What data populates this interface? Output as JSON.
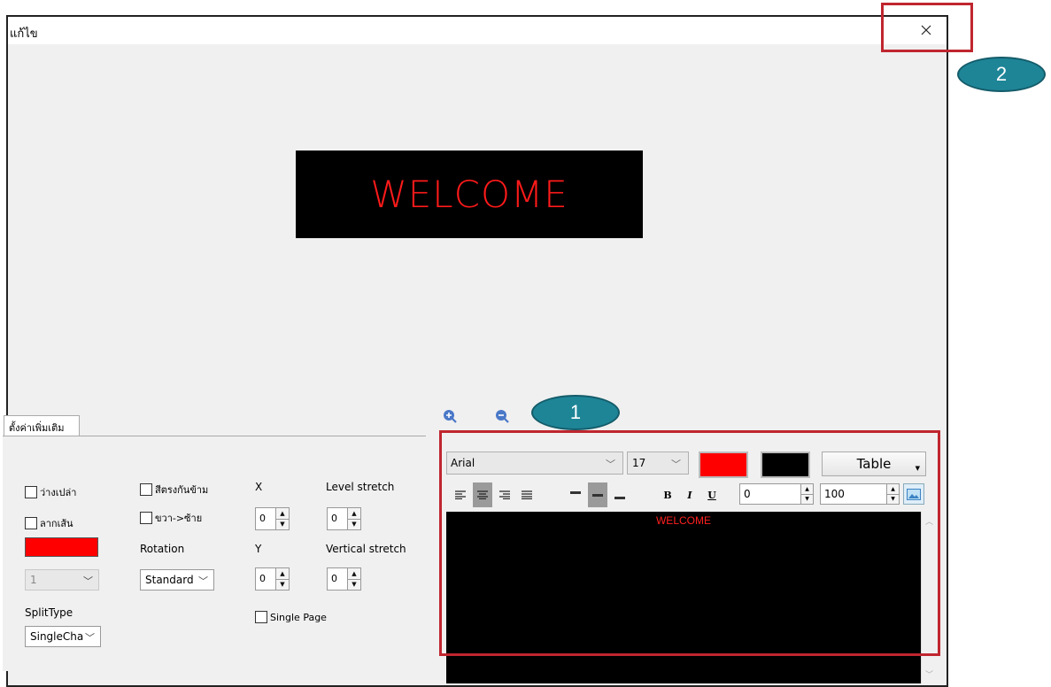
{
  "window": {
    "title": "แก้ไข",
    "close_icon": "close-icon"
  },
  "preview": {
    "text": "WELCOME",
    "text_color": "#ff1a1a",
    "background": "#000000"
  },
  "zoom": {
    "in_icon": "zoom-in-icon",
    "out_icon": "zoom-out-icon"
  },
  "settings": {
    "tab_label": "ตั้งค่าเพิ่มเติม",
    "checkbox_blank": "ว่างเปล่า",
    "checkbox_stroke": "ลากเส้น",
    "checkbox_invert": "สีตรงกันข้าม",
    "checkbox_rtl": "ขวา->ซ้าย",
    "stroke_color": "#ff0000",
    "stroke_width": "1",
    "rotation_label": "Rotation",
    "rotation_value": "Standard",
    "x_label": "X",
    "x_value": "0",
    "y_label": "Y",
    "y_value": "0",
    "level_stretch_label": "Level stretch",
    "level_stretch_value": "0",
    "vertical_stretch_label": "Vertical stretch",
    "vertical_stretch_value": "0",
    "single_page_label": "Single Page",
    "split_type_label": "SplitType",
    "split_type_value": "SingleCha"
  },
  "editor": {
    "font": "Arial",
    "size": "17",
    "fg_color": "#ff0000",
    "bg_color": "#000000",
    "table_label": "Table",
    "bold": "B",
    "italic": "I",
    "underline": "U",
    "spacing_value": "0",
    "scale_value": "100",
    "content": "WELCOME"
  },
  "annotations": {
    "callout_1": "1",
    "callout_2": "2",
    "highlight_color": "#c0262f",
    "callout_color": "#1e8597"
  }
}
